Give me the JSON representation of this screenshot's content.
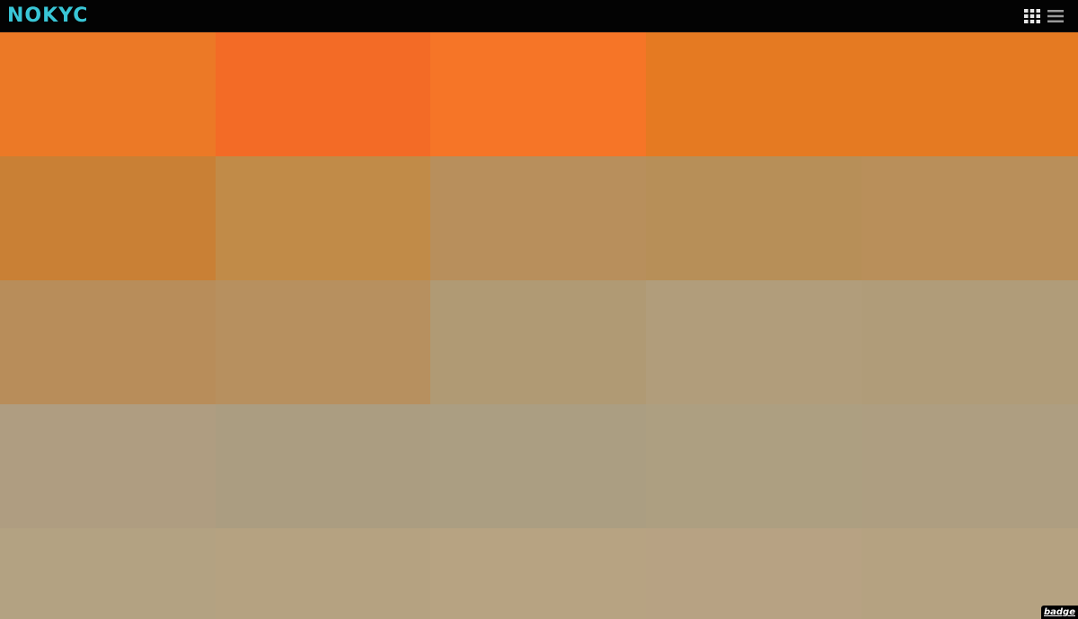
{
  "header": {
    "logo_text": "NOKYC",
    "logo_color": "#39c6d6",
    "grid_icon": "grid-icon",
    "menu_icon": "hamburger-menu-icon"
  },
  "palette_grid": {
    "rows": [
      [
        "#ec7926",
        "#f36b26",
        "#f67527",
        "#e57a22",
        "#e57a22"
      ],
      [
        "#c98035",
        "#c18b48",
        "#b88f5c",
        "#b78f58",
        "#b98f5a"
      ],
      [
        "#b88d5a",
        "#b7905f",
        "#b09a74",
        "#b19d7b",
        "#b09c79"
      ],
      [
        "#af9d81",
        "#ab9d81",
        "#ab9e82",
        "#ad9f81",
        "#ae9e81"
      ],
      [
        "#b3a282",
        "#b5a281",
        "#b7a382",
        "#b7a283",
        "#b5a281"
      ]
    ]
  },
  "badge": {
    "label": "badge"
  }
}
